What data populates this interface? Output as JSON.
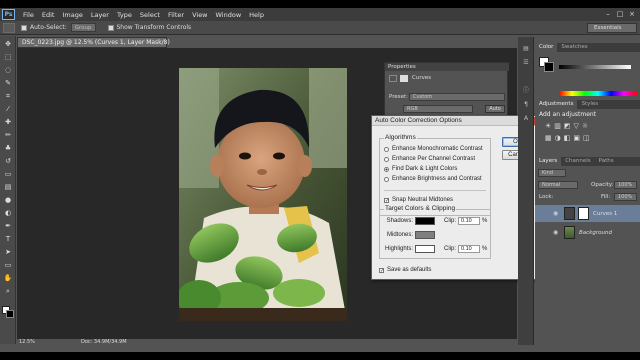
{
  "app": {
    "logo": "Ps"
  },
  "menu": [
    "File",
    "Edit",
    "Image",
    "Layer",
    "Type",
    "Select",
    "Filter",
    "View",
    "Window",
    "Help"
  ],
  "options_bar": {
    "auto_select_label": "Auto-Select:",
    "auto_select_value": "Group",
    "show_transform_label": "Show Transform Controls",
    "workspace": "Essentials"
  },
  "document": {
    "tab_title": "DSC_0223.jpg @ 12.5% (Curves 1, Layer Mask/8)",
    "zoom": "12.5%",
    "doc_info": "Doc: 34.9M/34.9M"
  },
  "properties": {
    "tab": "Properties",
    "adjustment": "Curves",
    "preset_label": "Preset:",
    "preset_value": "Custom",
    "channel_value": "RGB",
    "auto_label": "Auto"
  },
  "dialog": {
    "title": "Auto Color Correction Options",
    "algorithms_title": "Algorithms",
    "algorithms": [
      {
        "label": "Enhance Monochromatic Contrast",
        "selected": false
      },
      {
        "label": "Enhance Per Channel Contrast",
        "selected": false
      },
      {
        "label": "Find Dark & Light Colors",
        "selected": true
      },
      {
        "label": "Enhance Brightness and Contrast",
        "selected": false
      }
    ],
    "snap_label": "Snap Neutral Midtones",
    "snap_checked": true,
    "targets_title": "Target Colors & Clipping",
    "targets": [
      {
        "label": "Shadows:",
        "color": "#000000",
        "clip_label": "Clip:",
        "clip": "0.10",
        "unit": "%"
      },
      {
        "label": "Midtones:",
        "color": "#808080"
      },
      {
        "label": "Highlights:",
        "color": "#ffffff",
        "clip_label": "Clip:",
        "clip": "0.10",
        "unit": "%"
      }
    ],
    "save_label": "Save as defaults",
    "save_checked": true,
    "ok": "OK",
    "cancel": "Cancel"
  },
  "right_panels": {
    "color_tabs": [
      "Color",
      "Swatches"
    ],
    "adjust_tabs": [
      "Adjustments",
      "Styles"
    ],
    "adjust_heading": "Add an adjustment",
    "layer_tabs": [
      "Layers",
      "Channels",
      "Paths"
    ],
    "kind": "Kind",
    "blend": "Normal",
    "opacity_label": "Opacity:",
    "opacity": "100%",
    "fill_label": "Fill:",
    "fill": "100%",
    "lock_label": "Lock:",
    "layers": [
      {
        "name": "Curves 1"
      },
      {
        "name": "Background"
      }
    ]
  }
}
